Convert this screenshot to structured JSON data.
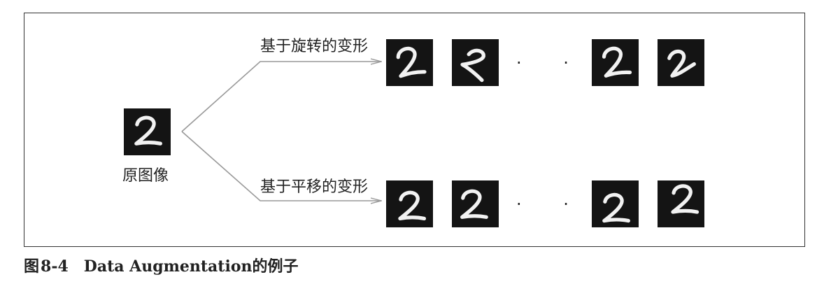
{
  "diagram": {
    "original_label": "原图像",
    "rotation_label": "基于旋转的变形",
    "translation_label": "基于平移的变形",
    "ellipsis_top": "· · ·",
    "ellipsis_bottom": "· · ·"
  },
  "caption": {
    "prefix": "图",
    "number": "8-4",
    "title": "Data Augmentation的例子"
  },
  "colors": {
    "tile_background": "#141414",
    "digit_stroke": "#f2f2f2",
    "arrow": "#999999",
    "frame_border": "#333333"
  }
}
